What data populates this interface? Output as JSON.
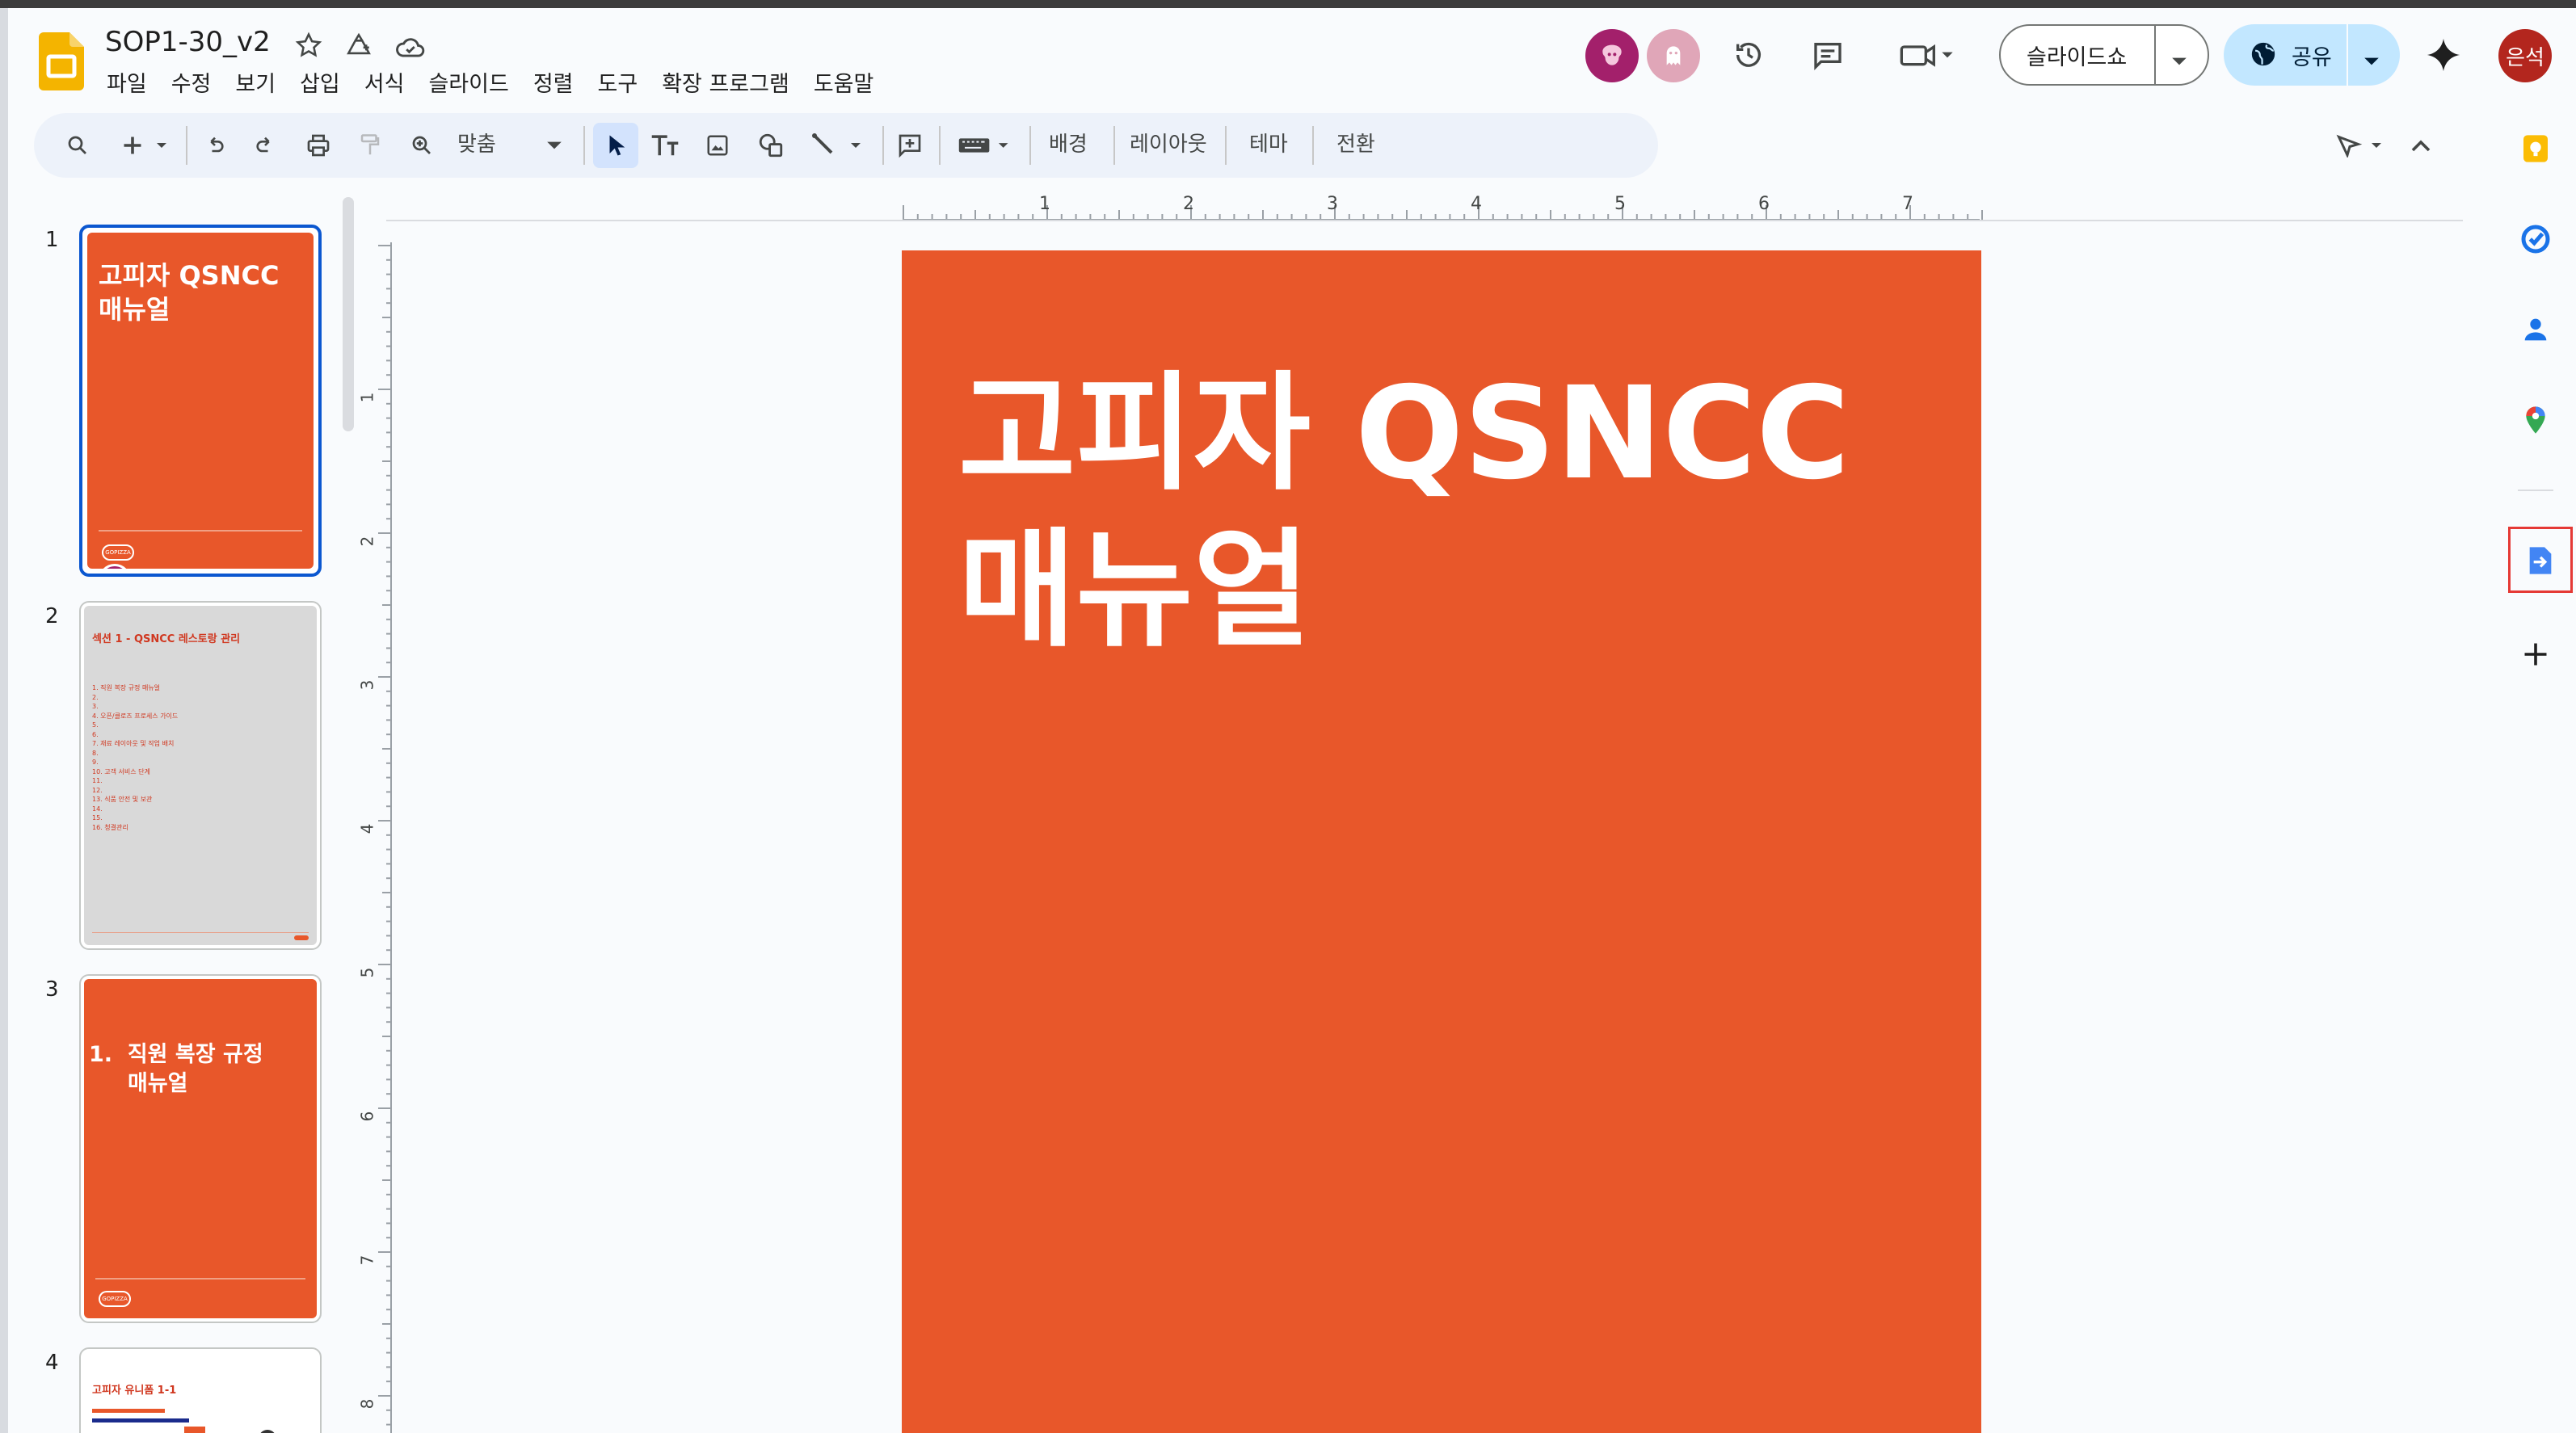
{
  "app": {
    "doc_title": "SOP1-30_v2",
    "menu": [
      "파일",
      "수정",
      "보기",
      "삽입",
      "서식",
      "슬라이드",
      "정렬",
      "도구",
      "확장 프로그램",
      "도움말"
    ],
    "slideshow_label": "슬라이드쇼",
    "share_label": "공유",
    "user_avatar_text": "은석",
    "accent_color": "#e8572a",
    "share_bg": "#c2e7ff"
  },
  "toolbar": {
    "zoom_label": "맞춤",
    "background_label": "배경",
    "layout_label": "레이아웃",
    "theme_label": "테마",
    "transition_label": "전환"
  },
  "ruler": {
    "h_numbers": [
      "1",
      "2",
      "3",
      "4",
      "5",
      "6",
      "7"
    ],
    "v_numbers": [
      "1",
      "2",
      "3",
      "4",
      "5",
      "6",
      "7",
      "8"
    ]
  },
  "slides": [
    {
      "num": "1",
      "title_line1": "고피자 QSNCC",
      "title_line2": "매뉴얼",
      "logo_text": "GOPIZZA"
    },
    {
      "num": "2",
      "title": "섹션 1 - QSNCC 레스토랑 관리",
      "items": [
        "1.  직원 복장 규정 매뉴얼",
        "2.",
        "3.",
        "4.  오픈/클로즈 프로세스 가이드",
        "5.",
        "6.",
        "7.  재료 레이아웃 및 작업 배치",
        "8.",
        "9.",
        "10.  고객 서비스 단계",
        "11.",
        "12.",
        "13.  식품 안전 및 보관",
        "14.",
        "15.",
        "16.  청결관리"
      ]
    },
    {
      "num": "3",
      "title_line1": "1.  직원 복장 규정",
      "title_line2": "매뉴얼",
      "logo_text": "GOPIZZA"
    },
    {
      "num": "4",
      "title": "고피자 유니폼 1-1"
    }
  ],
  "main_slide": {
    "title_line1": "고피자 QSNCC",
    "title_line2": "매뉴얼"
  }
}
